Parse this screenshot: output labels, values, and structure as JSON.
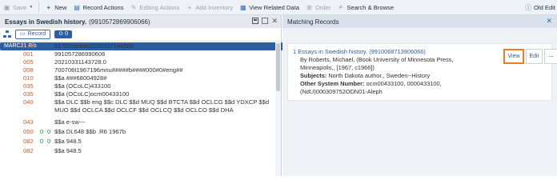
{
  "toolbar": {
    "save": "Save",
    "new": "New",
    "record_actions": "Record Actions",
    "editing_actions": "Editing Actions",
    "add_inventory": "Add Inventory",
    "view_related": "View Related Data",
    "order": "Order",
    "search_browse": "Search & Browse",
    "old_editor": "Old Edit"
  },
  "record": {
    "title": "Essays in Swedish history.",
    "id": "(9910572869906066)",
    "record_btn": "Record",
    "format": "MARC21 Bib",
    "count": "0"
  },
  "marc_rows": [
    {
      "tag": "LDR",
      "i1": "",
      "i2": "",
      "value": "01702cam#a22003371#4500"
    },
    {
      "tag": "001",
      "i1": "",
      "i2": "",
      "value": "991057286990606"
    },
    {
      "tag": "005",
      "i1": "",
      "i2": "",
      "value": "20210331143728.0"
    },
    {
      "tag": "008",
      "i1": "",
      "i2": "",
      "value": "700706t1967196mnu#####b####000#0#eng##"
    },
    {
      "tag": "010",
      "i1": "",
      "i2": "",
      "value": "$$a ###68004928#"
    },
    {
      "tag": "035",
      "i1": "",
      "i2": "",
      "value": "$$a (OCoLC)433100"
    },
    {
      "tag": "035",
      "i1": "",
      "i2": "",
      "value": "$$a (OCoLC)ocm00433100"
    },
    {
      "tag": "040",
      "i1": "",
      "i2": "",
      "value": "$$a DLC $$b eng $$c DLC $$d MUQ $$d BTCTA $$d OCLCG $$d YDXCP $$d"
    },
    {
      "tag": "",
      "i1": "",
      "i2": "",
      "value": "MUO $$d OCLCA $$d OCLCF $$d OCLCQ $$d OCLCO $$d DHA"
    },
    {
      "tag": "",
      "i1": "",
      "i2": "",
      "value": ""
    },
    {
      "tag": "043",
      "i1": "",
      "i2": "",
      "value": "$$a e-sw---"
    },
    {
      "tag": "050",
      "i1": "0",
      "i2": "0",
      "value": "$$a DL648 $$b .R6 1967b"
    },
    {
      "tag": "082",
      "i1": "0",
      "i2": "0",
      "value": "$$a 948.5"
    },
    {
      "tag": "082",
      "i1": "",
      "i2": "",
      "value": "$$a 948.5"
    }
  ],
  "matching": {
    "header": "Matching Records",
    "result_index": "1",
    "result_title": "Essays in Swedish history.",
    "result_id": "(9910068713906066)",
    "line2": "By Roberts, Michael, (Book University of Minnesota Press,",
    "line3": "Minneapolis,, [1967, c1966])",
    "subjects_label": "Subjects:",
    "subjects": "North Dakota author., Sweden--History",
    "other_label": "Other System Number:",
    "other": "ocm00433100, 0000433100,",
    "other2": "(NdU)000309752ODN01-Aleph",
    "view": "View",
    "edit": "Edit",
    "more": "..."
  }
}
